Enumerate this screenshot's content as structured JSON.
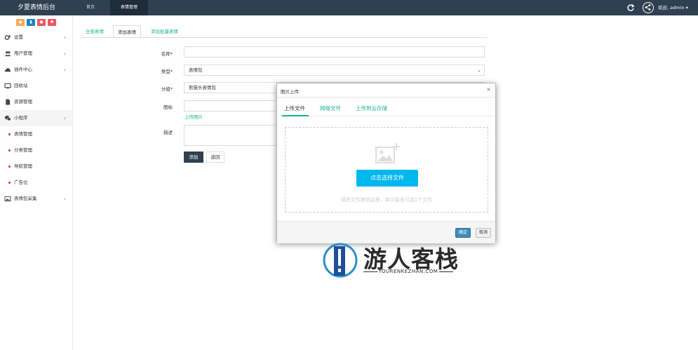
{
  "header": {
    "brand": "夕夏表情后台",
    "nav": [
      "首页",
      "表情管理"
    ],
    "active_nav_index": 1,
    "welcome": "欢迎, admin ▾",
    "icons": [
      "refresh-icon",
      "user-avatar-icon"
    ]
  },
  "sidebar": {
    "shortcut_colors": [
      "#f8ac59",
      "#1c84c6",
      "#ed5565",
      "#ed5565"
    ],
    "items": [
      {
        "label": "设置",
        "icon": "gear-icon",
        "arrow": "›"
      },
      {
        "label": "用户管理",
        "icon": "users-icon",
        "arrow": "›"
      },
      {
        "label": "插件中心",
        "icon": "cloud-icon",
        "arrow": "›"
      },
      {
        "label": "回收站",
        "icon": "monitor-icon",
        "arrow": ""
      },
      {
        "label": "资源管理",
        "icon": "file-icon",
        "arrow": ""
      },
      {
        "label": "小程序",
        "icon": "wechat-icon",
        "arrow": "›"
      }
    ],
    "sub_items": [
      "表情管理",
      "分类管理",
      "导航管理",
      "广告位"
    ],
    "last_item": {
      "label": "表情包采集",
      "icon": "image-icon",
      "arrow": "›"
    }
  },
  "tabs": [
    "全部表情",
    "添加表情",
    "添加批量表情"
  ],
  "active_tab_index": 1,
  "form": {
    "name_label": "名称*",
    "name_value": "",
    "type_label": "类型*",
    "type_value": "表情包",
    "category_label": "分组*",
    "category_value": "熊猫头表情包",
    "icon_label": "图标",
    "upload_link": "上传图片",
    "desc_label": "描述",
    "add_button": "添加",
    "back_button": "返回"
  },
  "modal": {
    "title": "图片上传",
    "close": "×",
    "tabs": [
      "上传文件",
      "网络文件",
      "上传到云存储"
    ],
    "active_tab_index": 0,
    "pick_button": "点击选择文件",
    "hint": "或将文件拖到这里，单次最多可选1个文件",
    "ok_button": "确定",
    "cancel_button": "取消"
  },
  "watermark": {
    "title": "游人客栈",
    "subtitle": "YOURENKEZHAN.COM"
  }
}
